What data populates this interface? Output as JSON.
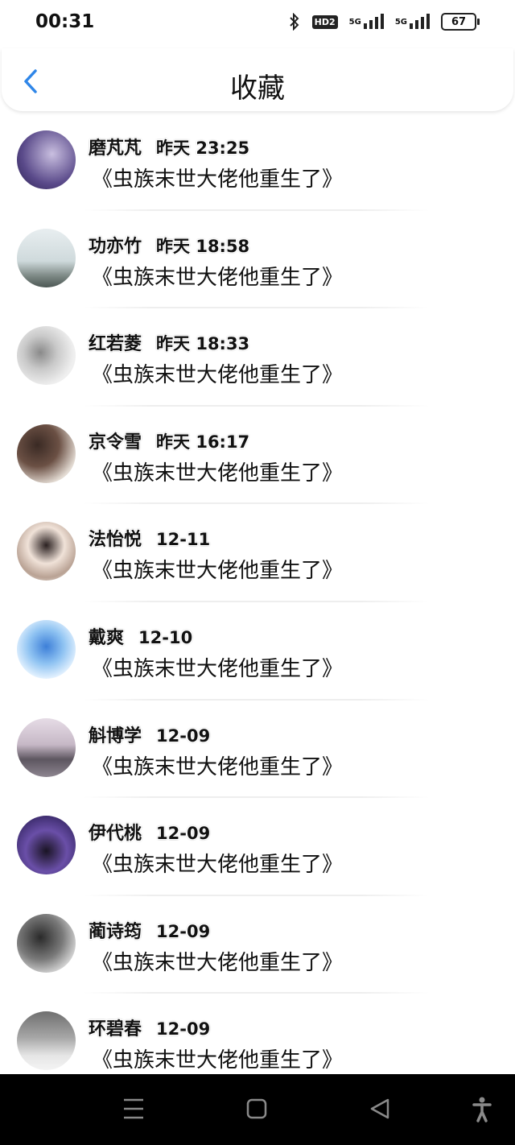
{
  "status_bar": {
    "time": "00:31",
    "hd_label": "HD2",
    "network_1": "5G",
    "network_2": "5G",
    "battery": "67"
  },
  "header": {
    "title": "收藏",
    "back_icon": "chevron-left-icon"
  },
  "colors": {
    "accent": "#2f86e8",
    "navbar": "#000000"
  },
  "favorites": [
    {
      "name": "磨芃芃",
      "date": "昨天 23:25",
      "book": "《虫族末世大佬他重生了》"
    },
    {
      "name": "功亦竹",
      "date": "昨天 18:58",
      "book": "《虫族末世大佬他重生了》"
    },
    {
      "name": "红若菱",
      "date": "昨天 18:33",
      "book": "《虫族末世大佬他重生了》"
    },
    {
      "name": "京令雪",
      "date": "昨天 16:17",
      "book": "《虫族末世大佬他重生了》"
    },
    {
      "name": "法怡悦",
      "date": "12-11",
      "book": "《虫族末世大佬他重生了》"
    },
    {
      "name": "戴爽",
      "date": "12-10",
      "book": "《虫族末世大佬他重生了》"
    },
    {
      "name": "斛博学",
      "date": "12-09",
      "book": "《虫族末世大佬他重生了》"
    },
    {
      "name": "伊代桃",
      "date": "12-09",
      "book": "《虫族末世大佬他重生了》"
    },
    {
      "name": "蔺诗筠",
      "date": "12-09",
      "book": "《虫族末世大佬他重生了》"
    },
    {
      "name": "环碧春",
      "date": "12-09",
      "book": "《虫族末世大佬他重生了》"
    }
  ],
  "navbar": {
    "icons": [
      "menu-icon",
      "home-square-icon",
      "back-triangle-icon",
      "accessibility-icon"
    ]
  }
}
